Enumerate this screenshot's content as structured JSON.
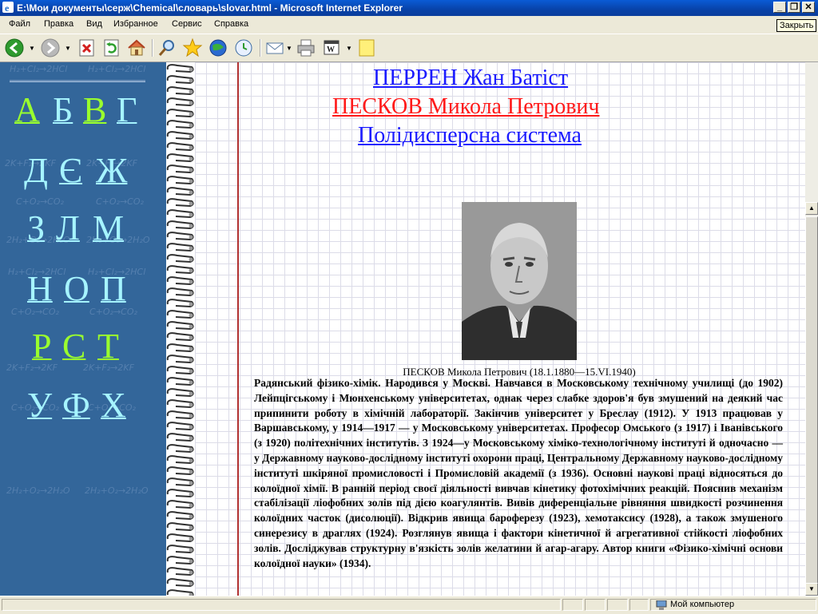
{
  "window": {
    "title": "E:\\Мои документы\\серж\\Chemical\\словарь\\slovar.html - Microsoft Internet Explorer",
    "controls": {
      "minimize": "_",
      "maximize": "❐",
      "close": "✕"
    },
    "close_tooltip": "Закрыть"
  },
  "menu": [
    "Файл",
    "Правка",
    "Вид",
    "Избранное",
    "Сервис",
    "Справка"
  ],
  "toolbar": {
    "icons": [
      "back-icon",
      "forward-icon",
      "stop-icon",
      "refresh-icon",
      "home-icon",
      "search-icon",
      "favorites-icon",
      "media-icon",
      "history-icon",
      "mail-icon",
      "print-icon",
      "edit-icon",
      "note-icon"
    ]
  },
  "nav": {
    "letters": [
      {
        "text": "А",
        "color": "#9aff2e"
      },
      {
        "text": "Б",
        "color": "#a6f4ff"
      },
      {
        "text": "В",
        "color": "#9aff2e"
      },
      {
        "text": "Г",
        "color": "#a6f4ff"
      },
      {
        "text": "Д",
        "color": "#a6f4ff"
      },
      {
        "text": "Є",
        "color": "#a6f4ff"
      },
      {
        "text": "Ж",
        "color": "#a6f4ff"
      },
      {
        "text": "З",
        "color": "#a6f4ff"
      },
      {
        "text": "Л",
        "color": "#a6f4ff"
      },
      {
        "text": "М",
        "color": "#a6f4ff"
      },
      {
        "text": "Н",
        "color": "#a6f4ff"
      },
      {
        "text": "О",
        "color": "#a6f4ff"
      },
      {
        "text": "П",
        "color": "#a6f4ff"
      },
      {
        "text": "Р",
        "color": "#9aff2e"
      },
      {
        "text": "С",
        "color": "#9aff2e"
      },
      {
        "text": "Т",
        "color": "#9aff2e"
      },
      {
        "text": "У",
        "color": "#a6f4ff"
      },
      {
        "text": "Ф",
        "color": "#a6f4ff"
      },
      {
        "text": "Х",
        "color": "#a6f4ff"
      }
    ],
    "background_formulas": [
      "H₂+Cl₂→2HCl",
      "H₂+Cl₂→2HCl",
      "2K+F₂→2KF",
      "2K+F₂→2KF",
      "C+O₂→CO₂",
      "C+O₂→CO₂",
      "2H₂+O₂→2H₂O",
      "2H₂+O₂→2H₂O",
      "H₂+Cl₂→2HCl",
      "H₂+Cl₂→2HCl",
      "C+O₂→CO₂",
      "C+O₂→CO₂",
      "2K+F₂→2KF",
      "2K+F₂→2KF",
      "C+O₂→CO₂",
      "C+O₂→CO₂",
      "2H₂+O₂→2H₂O",
      "2H₂+O₂→2H₂O"
    ]
  },
  "entries": [
    {
      "text": "ПЕРРЕН Жан Батіст",
      "color": "#1a1aff"
    },
    {
      "text": "ПЕСКОВ Микола Петрович",
      "color": "#ff1a1a"
    },
    {
      "text": "Полідисперсна система",
      "color": "#1a1aff"
    }
  ],
  "portrait_caption": "ПЕСКОВ Микола Петрович (18.1.1880—15.VI.1940)",
  "bio": "Радянський фізико-хімік. Народився у Москві. Навчався в Московському технічному училищі (до 1902) Лейпцігському і Мюнхенському університетах, однак через слабке здоров'я був змушений на деякий час припинити роботу в хімічній лабораторії. Закінчив університет у Бреслау (1912). У 1913 працював у Варшавському, у 1914—1917 — у Московському університетах. Професор Омського (з 1917) і Іванівського (з 1920) політехнічних інститутів. З 1924—у Московському хіміко-технологічному інституті й одночасно — у Державному науково-дослідному інституті охорони праці, Центральному Державному науково-дослідному інституті шкіряної промисловості і Промисловій академії (з 1936). Основні наукові праці відносяться до колоїдної хімії. В ранній період своєї діяльності вивчав кінетику фотохімічних реакцій. Пояснив механізм стабілізації ліофобних золів під дією коагулянтів. Вивів диференціальне рівняння швидкості розчинення колоїдних часток (дисолюції). Відкрив явища бароферезу (1923), хемотаксису (1928), а також змушеного синерезису в драглях (1924). Розглянув явища і фактори кінетичної й агрегативної стійкості ліофобних золів. Досліджував структурну в'язкість золів желатини й агар-агару. Автор книги «Фізико-хімічні основи колоїдної науки» (1934).",
  "statusbar": {
    "zone": "Мой компьютер"
  }
}
